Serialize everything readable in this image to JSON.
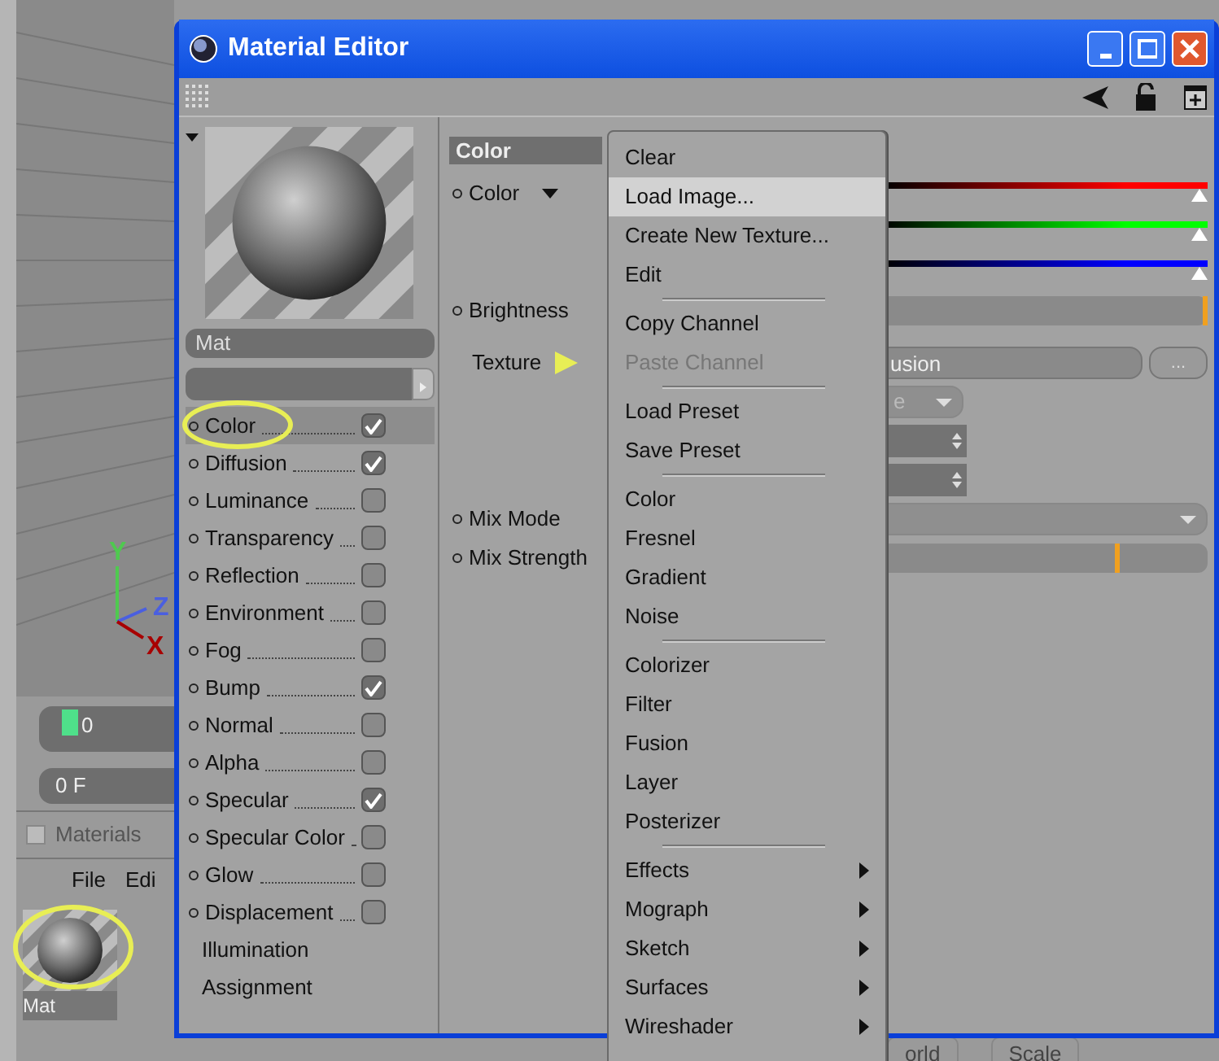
{
  "desktop_app": {
    "viewport": {
      "axis_labels": [
        {
          "text": "Y",
          "color": "#4fc94f"
        },
        {
          "text": "Z",
          "color": "#4a5fe0"
        },
        {
          "text": "X",
          "color": "#a80000"
        }
      ]
    },
    "timeline": {
      "frame": "0"
    },
    "frame_field": "0 F",
    "materials_panel": {
      "title": "Materials",
      "checked": false,
      "menu": [
        "File",
        "Edi"
      ],
      "materials": [
        {
          "name": "Mat",
          "annotated": true
        }
      ]
    },
    "bottom_fields": [
      "orld",
      "Scale"
    ]
  },
  "material_editor": {
    "title": "Material Editor",
    "name": "Mat",
    "channels": [
      {
        "label": "Color",
        "kind": "toggle",
        "checked": true,
        "selected": true,
        "annotated": true
      },
      {
        "label": "Diffusion",
        "kind": "toggle",
        "checked": true,
        "selected": false,
        "annotated": false
      },
      {
        "label": "Luminance",
        "kind": "toggle",
        "checked": false,
        "selected": false,
        "annotated": false
      },
      {
        "label": "Transparency",
        "kind": "toggle",
        "checked": false,
        "selected": false,
        "annotated": false
      },
      {
        "label": "Reflection",
        "kind": "toggle",
        "checked": false,
        "selected": false,
        "annotated": false
      },
      {
        "label": "Environment",
        "kind": "toggle",
        "checked": false,
        "selected": false,
        "annotated": false
      },
      {
        "label": "Fog",
        "kind": "toggle",
        "checked": false,
        "selected": false,
        "annotated": false
      },
      {
        "label": "Bump",
        "kind": "toggle",
        "checked": true,
        "selected": false,
        "annotated": false
      },
      {
        "label": "Normal",
        "kind": "toggle",
        "checked": false,
        "selected": false,
        "annotated": false
      },
      {
        "label": "Alpha",
        "kind": "toggle",
        "checked": false,
        "selected": false,
        "annotated": false
      },
      {
        "label": "Specular",
        "kind": "toggle",
        "checked": true,
        "selected": false,
        "annotated": false
      },
      {
        "label": "Specular Color",
        "kind": "toggle",
        "checked": false,
        "selected": false,
        "annotated": false
      },
      {
        "label": "Glow",
        "kind": "toggle",
        "checked": false,
        "selected": false,
        "annotated": false
      },
      {
        "label": "Displacement",
        "kind": "toggle",
        "checked": false,
        "selected": false,
        "annotated": false
      },
      {
        "label": "Illumination",
        "kind": "plain",
        "selected": false
      },
      {
        "label": "Assignment",
        "kind": "plain",
        "selected": false
      }
    ],
    "section": {
      "title": "Color",
      "params": [
        {
          "kind": "color",
          "label": "Color",
          "sliders": [
            {
              "color": "#ff0000",
              "level": 1
            },
            {
              "color": "#00ff00",
              "level": 1
            },
            {
              "color": "#0000ff",
              "level": 1
            }
          ]
        },
        {
          "kind": "slider",
          "label": "Brightness",
          "level": 1
        },
        {
          "kind": "texture",
          "label": "Texture",
          "button": "usion",
          "more": "...",
          "annotated": true
        },
        {
          "kind": "dropdown",
          "value": "e",
          "disabled": true
        },
        {
          "kind": "spinner"
        },
        {
          "kind": "spinner"
        },
        {
          "kind": "dropdown",
          "label": "Mix Mode"
        },
        {
          "kind": "slider",
          "label": "Mix Strength",
          "level": 0.73
        }
      ]
    }
  },
  "context_menu": {
    "items": [
      {
        "kind": "item",
        "label": "Clear",
        "selected": false,
        "disabled": false
      },
      {
        "kind": "item",
        "label": "Load Image...",
        "selected": true,
        "disabled": false
      },
      {
        "kind": "item",
        "label": "Create New Texture...",
        "selected": false,
        "disabled": false
      },
      {
        "kind": "item",
        "label": "Edit",
        "selected": false,
        "disabled": false
      },
      {
        "kind": "separator"
      },
      {
        "kind": "item",
        "label": "Copy Channel",
        "selected": false,
        "disabled": false
      },
      {
        "kind": "item",
        "label": "Paste Channel",
        "selected": false,
        "disabled": true
      },
      {
        "kind": "separator"
      },
      {
        "kind": "item",
        "label": "Load Preset",
        "selected": false,
        "disabled": false
      },
      {
        "kind": "item",
        "label": "Save Preset",
        "selected": false,
        "disabled": false
      },
      {
        "kind": "separator"
      },
      {
        "kind": "item",
        "label": "Color",
        "selected": false,
        "disabled": false
      },
      {
        "kind": "item",
        "label": "Fresnel",
        "selected": false,
        "disabled": false
      },
      {
        "kind": "item",
        "label": "Gradient",
        "selected": false,
        "disabled": false
      },
      {
        "kind": "item",
        "label": "Noise",
        "selected": false,
        "disabled": false
      },
      {
        "kind": "separator"
      },
      {
        "kind": "item",
        "label": "Colorizer",
        "selected": false,
        "disabled": false
      },
      {
        "kind": "item",
        "label": "Filter",
        "selected": false,
        "disabled": false
      },
      {
        "kind": "item",
        "label": "Fusion",
        "selected": false,
        "disabled": false
      },
      {
        "kind": "item",
        "label": "Layer",
        "selected": false,
        "disabled": false
      },
      {
        "kind": "item",
        "label": "Posterizer",
        "selected": false,
        "disabled": false
      },
      {
        "kind": "separator"
      },
      {
        "kind": "submenu",
        "label": "Effects",
        "selected": false,
        "disabled": false
      },
      {
        "kind": "submenu",
        "label": "Mograph",
        "selected": false,
        "disabled": false
      },
      {
        "kind": "submenu",
        "label": "Sketch",
        "selected": false,
        "disabled": false
      },
      {
        "kind": "submenu",
        "label": "Surfaces",
        "selected": false,
        "disabled": false
      },
      {
        "kind": "submenu",
        "label": "Wireshader",
        "selected": false,
        "disabled": false
      }
    ]
  }
}
